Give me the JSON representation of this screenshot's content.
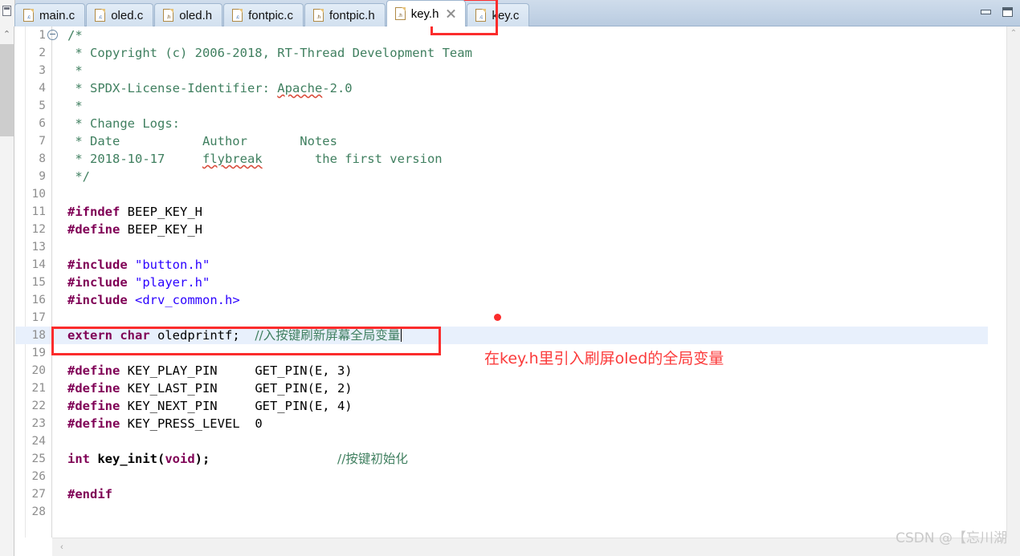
{
  "window": {
    "minimize_label": "Minimize",
    "maximize_label": "Restore",
    "left_stub_icon": "editor-stub-icon"
  },
  "tabs": [
    {
      "label": "main.c",
      "ext": ".c",
      "active": false,
      "closable": false
    },
    {
      "label": "oled.c",
      "ext": ".c",
      "active": false,
      "closable": false
    },
    {
      "label": "oled.h",
      "ext": ".h",
      "active": false,
      "closable": false
    },
    {
      "label": "fontpic.c",
      "ext": ".c",
      "active": false,
      "closable": false
    },
    {
      "label": "fontpic.h",
      "ext": ".h",
      "active": false,
      "closable": false
    },
    {
      "label": "key.h",
      "ext": ".h",
      "active": true,
      "closable": true
    },
    {
      "label": "key.c",
      "ext": ".c",
      "active": false,
      "closable": false
    }
  ],
  "editor": {
    "active_file": "key.h",
    "cursor_line": 18,
    "highlighted_line": 18,
    "fold_marker_line": 1,
    "lines": [
      {
        "n": "1",
        "text": "/*"
      },
      {
        "n": "2",
        "text": " * Copyright (c) 2006-2018, RT-Thread Development Team"
      },
      {
        "n": "3",
        "text": " *"
      },
      {
        "n": "4",
        "text": " * SPDX-License-Identifier: Apache-2.0"
      },
      {
        "n": "5",
        "text": " *"
      },
      {
        "n": "6",
        "text": " * Change Logs:"
      },
      {
        "n": "7",
        "text": " * Date           Author       Notes"
      },
      {
        "n": "8",
        "text": " * 2018-10-17     flybreak       the first version"
      },
      {
        "n": "9",
        "text": " */"
      },
      {
        "n": "10",
        "text": ""
      },
      {
        "n": "11",
        "text": "#ifndef BEEP_KEY_H"
      },
      {
        "n": "12",
        "text": "#define BEEP_KEY_H"
      },
      {
        "n": "13",
        "text": ""
      },
      {
        "n": "14",
        "text": "#include \"button.h\""
      },
      {
        "n": "15",
        "text": "#include \"player.h\""
      },
      {
        "n": "16",
        "text": "#include <drv_common.h>"
      },
      {
        "n": "17",
        "text": ""
      },
      {
        "n": "18",
        "text": "extern char oledprintf;  //入按键刷新屏幕全局变量"
      },
      {
        "n": "19",
        "text": ""
      },
      {
        "n": "20",
        "text": "#define KEY_PLAY_PIN     GET_PIN(E, 3)"
      },
      {
        "n": "21",
        "text": "#define KEY_LAST_PIN     GET_PIN(E, 2)"
      },
      {
        "n": "22",
        "text": "#define KEY_NEXT_PIN     GET_PIN(E, 4)"
      },
      {
        "n": "23",
        "text": "#define KEY_PRESS_LEVEL  0"
      },
      {
        "n": "24",
        "text": ""
      },
      {
        "n": "25",
        "text": "int key_init(void);                 //按键初始化"
      },
      {
        "n": "26",
        "text": ""
      },
      {
        "n": "27",
        "text": "#endif"
      },
      {
        "n": "28",
        "text": ""
      }
    ],
    "tokens": {
      "line1": {
        "comment": "/*"
      },
      "line2": {
        "comment": " * Copyright (c) 2006-2018, RT-Thread Development Team"
      },
      "line3": {
        "comment": " *"
      },
      "line4a": {
        "comment": " * SPDX-License-Identifier: "
      },
      "line4b": {
        "comment": "Apache"
      },
      "line4c": {
        "comment": "-2.0"
      },
      "line5": {
        "comment": " *"
      },
      "line6": {
        "comment": " * Change Logs:"
      },
      "line7": {
        "comment": " * Date           Author       Notes"
      },
      "line8a": {
        "comment": " * 2018-10-17     "
      },
      "line8b": {
        "comment": "flybreak"
      },
      "line8c": {
        "comment": "       the first version"
      },
      "line9": {
        "comment": " */"
      },
      "line11_kw": "#ifndef",
      "line11_rest": " BEEP_KEY_H",
      "line12_kw": "#define",
      "line12_rest": " BEEP_KEY_H",
      "line14_kw": "#include",
      "line14_str": "\"button.h\"",
      "line15_kw": "#include",
      "line15_str": "\"player.h\"",
      "line16_kw": "#include",
      "line16_str": "<drv_common.h>",
      "line18_kw1": "extern",
      "line18_kw2": "char",
      "line18_id": " oledprintf;  ",
      "line18_cm": "//入按键刷新屏幕全局变量",
      "line20_kw": "#define",
      "line20_name": " KEY_PLAY_PIN     ",
      "line20_val": "GET_PIN(E, 3)",
      "line21_kw": "#define",
      "line21_name": " KEY_LAST_PIN     ",
      "line21_val": "GET_PIN(E, 2)",
      "line22_kw": "#define",
      "line22_name": " KEY_NEXT_PIN     ",
      "line22_val": "GET_PIN(E, 4)",
      "line23_kw": "#define",
      "line23_name": " KEY_PRESS_LEVEL  ",
      "line23_val": "0",
      "line25_kw1": "int",
      "line25_fn": " key_init",
      "line25_p1": "(",
      "line25_kw2": "void",
      "line25_p2": ");                 ",
      "line25_cm": "//按键初始化",
      "line27_kw": "#endif"
    }
  },
  "annotations": {
    "note_text": "在key.h里引入刷屏oled的全局变量",
    "note_color": "#fb3b3b",
    "box_color": "#fb2c2c",
    "dot_color": "#fb2c2c"
  },
  "watermark": {
    "text": "CSDN @【忘川湖"
  },
  "icons": {
    "scroll_up": "⌃",
    "scroll_left": "‹",
    "fold_collapse": "−"
  },
  "colors": {
    "comment": "#3f7f5f",
    "preprocessor": "#7f0055",
    "string": "#2a00ff",
    "line_highlight": "#e8f0fc",
    "line_number": "#8e8e8e"
  }
}
